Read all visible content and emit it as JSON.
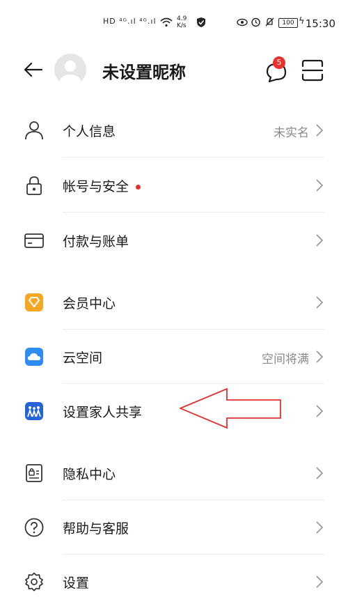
{
  "status_bar": {
    "left_indicators": "HD ⁴ᴳ.ıl ⁴ᴳ.ıl",
    "speed": "4.9 K/s",
    "battery": "100",
    "time": "15:30"
  },
  "header": {
    "title": "未设置昵称",
    "message_badge": "5"
  },
  "menu": {
    "personal_info": {
      "label": "个人信息",
      "status": "未实名"
    },
    "account_security": {
      "label": "帐号与安全"
    },
    "payment": {
      "label": "付款与账单"
    },
    "member": {
      "label": "会员中心"
    },
    "cloud": {
      "label": "云空间",
      "status": "空间将满"
    },
    "family": {
      "label": "设置家人共享"
    },
    "privacy": {
      "label": "隐私中心"
    },
    "help": {
      "label": "帮助与客服"
    },
    "settings": {
      "label": "设置"
    }
  },
  "colors": {
    "accent_red": "#e3312f",
    "member_orange": "#f5a623",
    "cloud_blue": "#2f8bf5",
    "family_blue": "#2563d9"
  }
}
